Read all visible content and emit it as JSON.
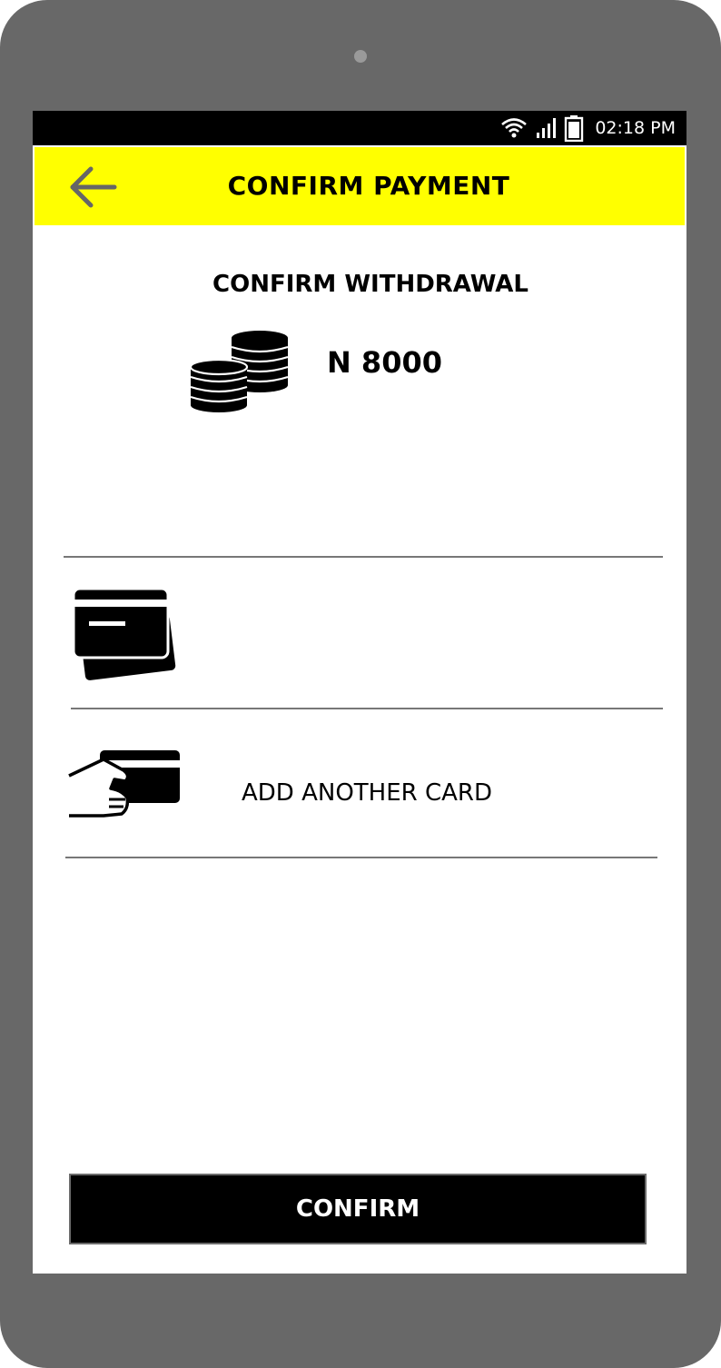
{
  "status_bar": {
    "time": "02:18 PM",
    "icons": [
      "wifi-icon",
      "signal-icon",
      "battery-icon"
    ]
  },
  "app_bar": {
    "title": "CONFIRM PAYMENT",
    "back_icon": "arrow-left-icon",
    "background_color": "#ffff00"
  },
  "withdrawal": {
    "title": "CONFIRM WITHDRAWAL",
    "amount": "N 8000",
    "icon": "coins-icon"
  },
  "cards": {
    "saved_card_icon": "credit-card-icon",
    "add_card_label": "ADD ANOTHER CARD",
    "add_card_icon": "hand-card-icon"
  },
  "footer": {
    "confirm_label": "CONFIRM",
    "button_color": "#000000"
  },
  "device": {
    "frame_color": "#686868"
  }
}
